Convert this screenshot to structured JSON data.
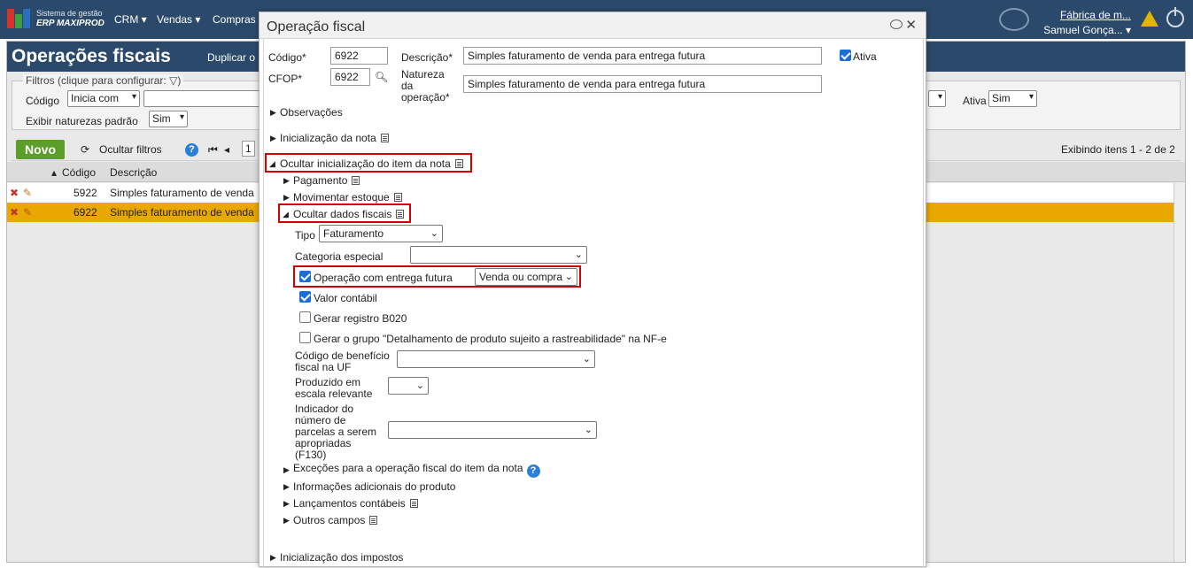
{
  "app": {
    "logo_line1": "Sistema de gestão",
    "logo_line2": "ERP MAXIPROD"
  },
  "menu": {
    "crm": "CRM",
    "vendas": "Vendas",
    "compras": "Compras"
  },
  "user": {
    "company": "Fábrica de m...",
    "name": "Samuel Gonça..."
  },
  "page": {
    "title": "Operações fiscais",
    "duplicate": "Duplicar o",
    "filters_legend": "Filtros (clique para configurar:",
    "codigo_label": "Código",
    "codigo_op": "Inicia com",
    "exibir_label": "Exibir naturezas padrão",
    "exibir_value": "Sim",
    "ativa_label": "Ativa",
    "ativa_value": "Sim",
    "novo": "Novo",
    "ocultar_filtros": "Ocultar filtros",
    "page_num": "1",
    "exibindo": "Exibindo itens 1 - 2 de 2"
  },
  "grid": {
    "col_codigo": "Código",
    "col_descricao": "Descrição",
    "rows": [
      {
        "codigo": "5922",
        "descricao": "Simples faturamento de venda"
      },
      {
        "codigo": "6922",
        "descricao": "Simples faturamento de venda"
      }
    ]
  },
  "modal": {
    "title": "Operação fiscal",
    "codigo_label": "Código*",
    "codigo_value": "6922",
    "descricao_label": "Descrição*",
    "descricao_value": "Simples faturamento de venda para entrega futura",
    "ativa_label": "Ativa",
    "cfop_label": "CFOP*",
    "cfop_value": "6922",
    "natureza_label_1": "Natureza",
    "natureza_label_2": "da",
    "natureza_label_3": "operação*",
    "natureza_value": "Simples faturamento de venda para entrega futura",
    "observacoes": "Observações",
    "inicializacao_nota": "Inicialização da nota",
    "ocultar_item": "Ocultar inicialização do item da nota",
    "pagamento": "Pagamento",
    "movimentar": "Movimentar estoque",
    "ocultar_fiscais": "Ocultar dados fiscais",
    "tipo_label": "Tipo",
    "tipo_value": "Faturamento",
    "categoria_label": "Categoria especial",
    "entrega_futura_label": "Operação com entrega futura",
    "entrega_futura_value": "Venda ou compra",
    "valor_contabil": "Valor contábil",
    "b020": "Gerar registro B020",
    "rastreabilidade": "Gerar o grupo \"Detalhamento de produto sujeito a rastreabilidade\" na NF-e",
    "beneficio_1": "Código de benefício",
    "beneficio_2": "fiscal na UF",
    "produzido_1": "Produzido em",
    "produzido_2": "escala relevante",
    "parcelas_1": "Indicador do",
    "parcelas_2": "número de",
    "parcelas_3": "parcelas a serem",
    "parcelas_4": "apropriadas",
    "parcelas_5": "(F130)",
    "excecoes": "Exceções para a operação fiscal do item da nota",
    "info_adicionais": "Informações adicionais do produto",
    "lancamentos": "Lançamentos contábeis",
    "outros": "Outros campos",
    "impostos": "Inicialização dos impostos"
  }
}
